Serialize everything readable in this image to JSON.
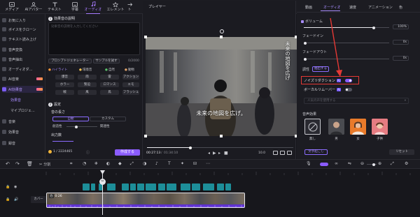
{
  "topbar": {
    "tabs": [
      {
        "label": "メディア",
        "icon": "media-icon"
      },
      {
        "label": "AIアバター",
        "icon": "avatar-icon"
      },
      {
        "label": "テキスト",
        "icon": "text-icon"
      },
      {
        "label": "字幕",
        "icon": "subtitle-icon"
      },
      {
        "label": "オーディオ",
        "icon": "music-icon",
        "active": true
      },
      {
        "label": "エレメント",
        "icon": "element-icon"
      },
      {
        "label": "ト",
        "icon": "transition-icon"
      }
    ]
  },
  "sidebar": {
    "items": [
      {
        "label": "お気に入り"
      },
      {
        "label": "ボイスをクローン"
      },
      {
        "label": "テキスト読み上げ"
      },
      {
        "label": "音声変換"
      },
      {
        "label": "音声抽出"
      },
      {
        "label": "オーディオダ..."
      },
      {
        "label": "AI音楽"
      },
      {
        "label": "AI効果音"
      },
      {
        "label": "効果音"
      },
      {
        "label": "マイプロジェ..."
      },
      {
        "label": "音楽"
      },
      {
        "label": "効果音"
      },
      {
        "label": "録音"
      }
    ]
  },
  "generator": {
    "section1_title": "効果音の説明",
    "prompt_placeholder": "効果音の説明を入力してください",
    "prompt_generator": "プロンプトジェネレーター",
    "sample": "サンプルを試す",
    "char_count": "0/2000",
    "chips": [
      "ハイライト",
      "環境音",
      "自然",
      "動物"
    ],
    "tags": [
      "爆音",
      "雨",
      "雷",
      "アクション",
      "ホラー",
      "緊迫",
      "ロマンス",
      "エモ",
      "戦",
      "風",
      "鳥",
      "フラッシュ"
    ],
    "section2_title": "設定",
    "length_label": "音の長さ",
    "length_options": [
      "自動",
      "カスタム"
    ],
    "relevance_label": "創造性",
    "relevance_right": "関連性",
    "output_label": "出力数",
    "credits": "1 / 2224465",
    "create": "作成する"
  },
  "player": {
    "title": "プレイヤー",
    "caption_main": "未来の地図を広げ。",
    "caption_vertical": "未来の地図を広げ",
    "time_current": "00:27:13",
    "time_total": "01:34:10",
    "zoom": "10.0"
  },
  "rightpanel": {
    "tabs": [
      "動画",
      "オーディオ",
      "速度",
      "アニメーション",
      "色"
    ],
    "active_tab": "オーディオ",
    "volume_label": "ボリューム",
    "volume_value": "100%",
    "volume_level": 0.82,
    "fadein_label": "フェードイン",
    "fadein_value": "0s",
    "fadeout_label": "フェードアウト",
    "fadeout_value": "0s",
    "pitch_label": "調性",
    "pitch_btn": "抽出する",
    "noise_label": "ノイズリダクション",
    "noise_badge": "AI",
    "vocal_label": "ボーカルリムーバー",
    "vocal_badge": "AI",
    "dropdown_placeholder": "人気の声を使用する",
    "voice_fx_label": "音声効果",
    "voices": [
      "無し",
      "男",
      "女",
      "子供"
    ],
    "text_to_speech": "文字起こし",
    "reset": "リセット"
  },
  "timeline": {
    "split_label": "分割",
    "track_label": "カバー",
    "clip_label": "カ",
    "clip_time": "0:26",
    "seg_labels": [
      "",
      ",",
      "",
      ",",
      "",
      "",
      ",",
      "",
      "",
      ",",
      "",
      "",
      ",",
      ""
    ]
  },
  "colors": {
    "accent": "#8b5cff",
    "highlight_box": "#e53935",
    "audio_wave": "#7b3ef0",
    "text_track": "#1d8e99"
  }
}
